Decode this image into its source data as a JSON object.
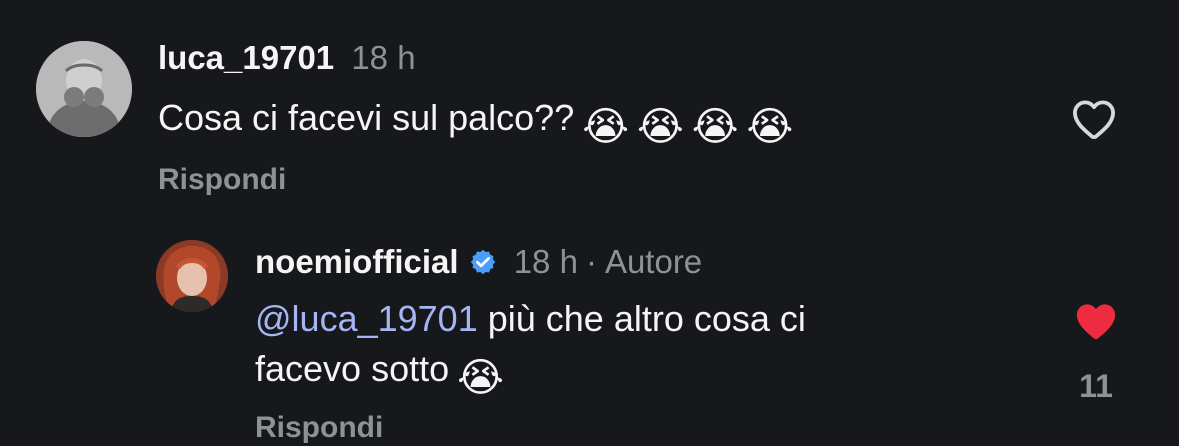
{
  "comments": [
    {
      "username": "luca_19701",
      "time": "18 h",
      "text": "Cosa ci facevi sul palco??",
      "emojis": [
        "😭",
        "😭",
        "😭",
        "😭"
      ],
      "reply_label": "Rispondi",
      "avatar_icon": "user-avatar-photo",
      "like_icon": "heart-outline-icon",
      "liked": false
    },
    {
      "username": "noemiofficial",
      "verified": true,
      "time": "18 h",
      "separator": "·",
      "author_badge": "Autore",
      "mention": "@luca_19701",
      "text_line1": "più che altro cosa ci",
      "text_line2": "facevo sotto",
      "emojis": [
        "😭"
      ],
      "reply_label": "Rispondi",
      "avatar_icon": "user-avatar-photo",
      "like_icon": "heart-filled-icon",
      "liked": true,
      "like_count": "11"
    }
  ],
  "colors": {
    "background": "#16181c",
    "text": "#f5f5f5",
    "muted": "#8e9196",
    "mention": "#a5b5f4",
    "verified": "#4a9df8",
    "like_active": "#ee2b40"
  }
}
